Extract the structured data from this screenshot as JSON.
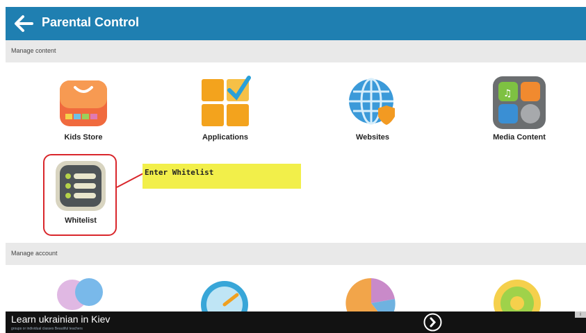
{
  "appbar": {
    "title": "Parental Control"
  },
  "sections": {
    "manage_content": "Manage content",
    "manage_account": "Manage account"
  },
  "content_items": [
    {
      "label": "Kids Store",
      "icon": "shopping-bag-icon"
    },
    {
      "label": "Applications",
      "icon": "applications-grid-icon"
    },
    {
      "label": "Websites",
      "icon": "globe-shield-icon"
    },
    {
      "label": "Media Content",
      "icon": "media-content-icon"
    },
    {
      "label": "Whitelist",
      "icon": "whitelist-icon"
    }
  ],
  "account_items": [
    {
      "icon": "users-icon"
    },
    {
      "icon": "gauge-icon"
    },
    {
      "icon": "pie-chart-icon"
    },
    {
      "icon": "gear-icon"
    }
  ],
  "annotation": {
    "text": "Enter Whitelist"
  },
  "ad": {
    "title": "Learn ukrainian in Kiev",
    "subtitle": "groups or individual classes Beautiful teachers"
  },
  "colors": {
    "appbar": "#1f7fb1",
    "highlight": "#d9262b",
    "callout": "#f2ef4a",
    "section": "#e9e9e9"
  }
}
